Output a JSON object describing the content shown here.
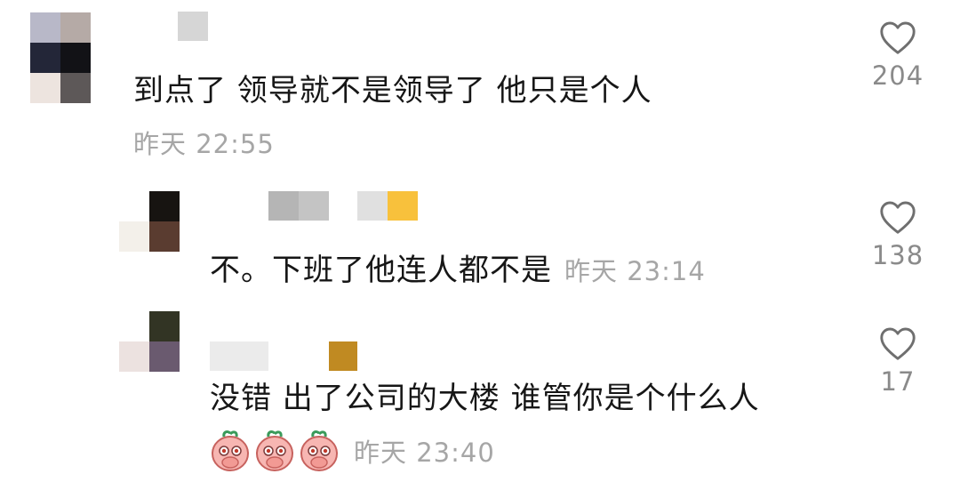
{
  "comments": [
    {
      "text": "到点了  领导就不是领导了 他只是个人",
      "timestamp": "昨天 22:55",
      "likes": "204",
      "avatar_pixels": [
        "#b8b8c8",
        "#b5aaa6",
        "#232638",
        "#121216",
        "#ede4df",
        "#5d5858"
      ],
      "name_pixels": [
        "#d6d6d6"
      ]
    },
    {
      "text": "不。下班了他连人都不是",
      "timestamp": "昨天 23:14",
      "likes": "138",
      "avatar_pixels": [
        "#ffffff",
        "#171411",
        "#f3f0ea",
        "#5a3c30"
      ],
      "name_pixels": [
        "#b5b5b5",
        "#c4c4c4",
        "#e0e0e0",
        "#f8c13c"
      ]
    },
    {
      "text": "没错 出了公司的大楼 谁管你是个什么人",
      "timestamp": "昨天 23:40",
      "likes": "17",
      "avatar_pixels": [
        "#ffffff",
        "#323424",
        "#ece2e0",
        "#6a5a6f"
      ],
      "name_pixels": [
        "#ebebeb",
        "#c08a22"
      ],
      "emoji_count": 3,
      "emoji_name": "peach-facepalm-emoji"
    }
  ],
  "colors": {
    "text": "#161616",
    "meta": "#a6a6a6",
    "like_count": "#8a8a8a",
    "heart_stroke": "#6f6f6f",
    "emoji_body": "#f7b6b2"
  },
  "icons": {
    "like": "heart-outline-icon"
  }
}
